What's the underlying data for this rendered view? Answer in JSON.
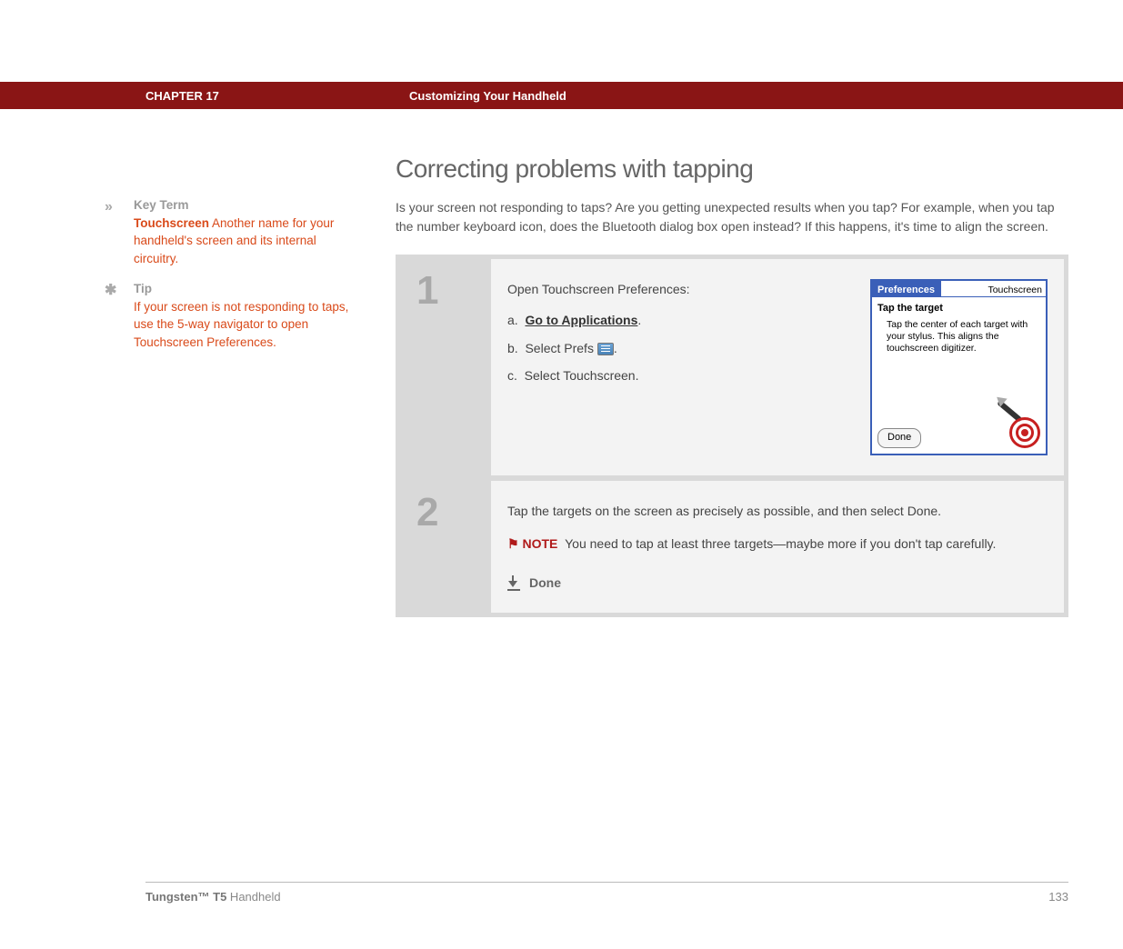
{
  "header": {
    "chapter": "CHAPTER 17",
    "title": "Customizing Your Handheld"
  },
  "sidebar": {
    "keyterm": {
      "label": "Key Term",
      "term": "Touchscreen",
      "text": "Another name for your handheld's screen and its internal circuitry."
    },
    "tip": {
      "label": "Tip",
      "text": "If your screen is not responding to taps, use the 5-way navigator to open Touchscreen Preferences."
    }
  },
  "main": {
    "heading": "Correcting problems with tapping",
    "intro": "Is your screen not responding to taps? Are you getting unexpected results when you tap? For example, when you tap the number keyboard icon, does the Bluetooth dialog box open instead? If this happens, it's time to align the screen."
  },
  "steps": [
    {
      "num": "1",
      "lead": "Open Touchscreen Preferences:",
      "a_prefix": "a.",
      "a_link": "Go to Applications",
      "a_suffix": ".",
      "b_prefix": "b.",
      "b_before": "Select Prefs",
      "b_after": ".",
      "c_prefix": "c.",
      "c_text": "Select Touchscreen."
    },
    {
      "num": "2",
      "text": "Tap the targets on the screen as precisely as possible, and then select Done.",
      "note_label": "NOTE",
      "note_text": "You need to tap at least three targets—maybe more if you don't tap carefully.",
      "done": "Done"
    }
  ],
  "palm": {
    "tab": "Preferences",
    "right": "Touchscreen",
    "title": "Tap the target",
    "body": "Tap the center of each target with your stylus. This aligns the touchscreen digitizer.",
    "done": "Done"
  },
  "footer": {
    "product_bold": "Tungsten™ T5",
    "product_rest": " Handheld",
    "page": "133"
  }
}
